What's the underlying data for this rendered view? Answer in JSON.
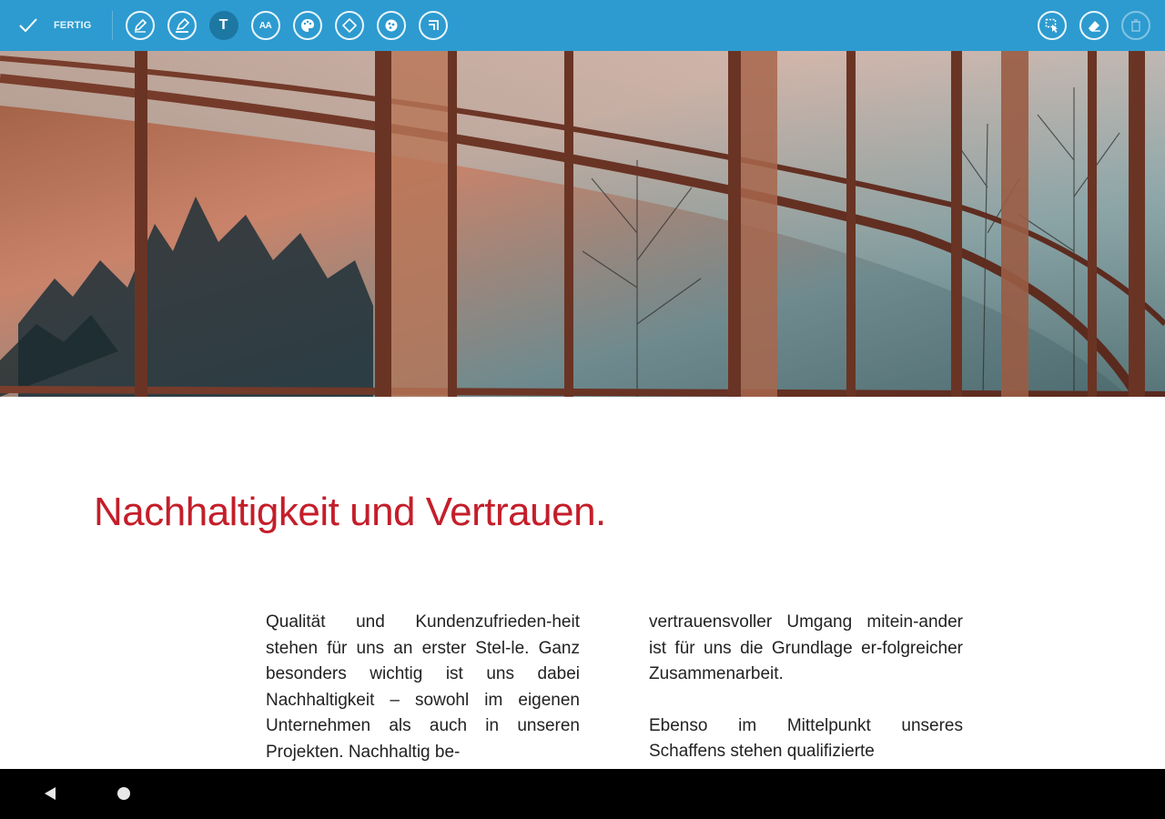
{
  "toolbar": {
    "done_label": "FERTIG",
    "tools": [
      {
        "name": "pen-tool-icon"
      },
      {
        "name": "highlighter-tool-icon"
      },
      {
        "name": "text-tool-icon",
        "glyph": "T"
      },
      {
        "name": "font-size-tool-icon",
        "glyph": "AA"
      },
      {
        "name": "color-palette-tool-icon"
      },
      {
        "name": "shape-tool-icon"
      },
      {
        "name": "stamp-tool-icon"
      },
      {
        "name": "crop-tool-icon"
      }
    ],
    "right_tools": [
      {
        "name": "select-tool-icon"
      },
      {
        "name": "eraser-tool-icon"
      },
      {
        "name": "trash-icon"
      }
    ],
    "accent": "#2d9bd0"
  },
  "document": {
    "title": "Nachhaltigkeit und Vertrauen.",
    "title_color": "#c41e2a",
    "column1": [
      "Qualität und Kundenzufrieden-heit stehen für uns an erster Stel-le. Ganz besonders wichtig ist uns dabei Nachhaltigkeit – sowohl im eigenen Unternehmen als auch in unseren Projekten. Nachhaltig be-"
    ],
    "column2": [
      "vertrauensvoller Umgang mitein-ander ist für uns die Grundlage er-folgreicher Zusammenarbeit.",
      "Ebenso im Mittelpunkt unseres Schaffens stehen qualifizierte"
    ]
  },
  "navbar": {
    "back_icon": "back-triangle-icon",
    "home_icon": "home-circle-icon"
  }
}
